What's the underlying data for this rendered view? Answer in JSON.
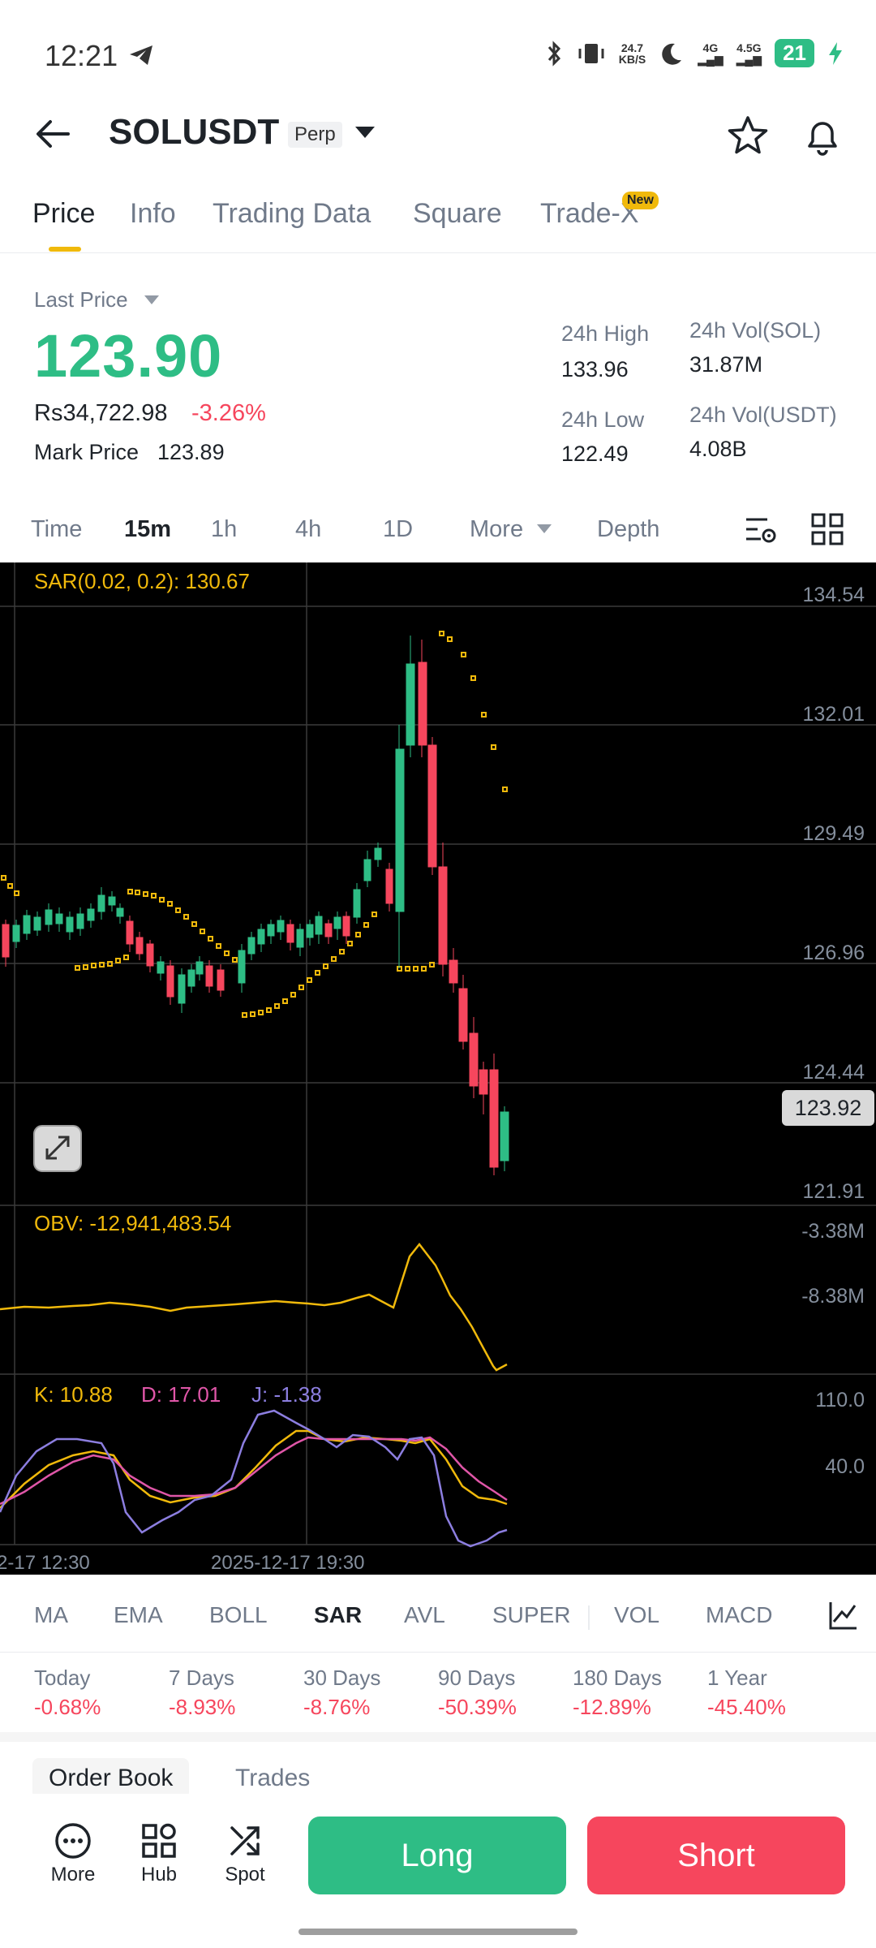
{
  "status_bar": {
    "time": "12:21",
    "net_speed_top": "24.7",
    "net_speed_bottom": "KB/S",
    "network_1": "4G",
    "network_2": "4.5G",
    "battery": "21"
  },
  "header": {
    "symbol": "SOLUSDT",
    "contract_type": "Perp"
  },
  "tabs": [
    {
      "label": "Price"
    },
    {
      "label": "Info"
    },
    {
      "label": "Trading Data"
    },
    {
      "label": "Square"
    },
    {
      "label": "Trade-X"
    }
  ],
  "new_badge": "New",
  "price_panel": {
    "last_price_label": "Last Price",
    "last_price": "123.90",
    "inr_price": "Rs34,722.98",
    "change_pct": "-3.26%",
    "mark_price_label": "Mark Price",
    "mark_price": "123.89",
    "high_label": "24h High",
    "high_value": "133.96",
    "low_label": "24h Low",
    "low_value": "122.49",
    "vol_sol_label": "24h Vol(SOL)",
    "vol_sol_value": "31.87M",
    "vol_usdt_label": "24h Vol(USDT)",
    "vol_usdt_value": "4.08B"
  },
  "intervals": [
    {
      "label": "Time"
    },
    {
      "label": "15m"
    },
    {
      "label": "1h"
    },
    {
      "label": "4h"
    },
    {
      "label": "1D"
    },
    {
      "label": "More"
    },
    {
      "label": "Depth"
    }
  ],
  "chart": {
    "sar_label": "SAR(0.02, 0.2): 130.67",
    "price_axis": [
      "134.54",
      "132.01",
      "129.49",
      "126.96",
      "124.44",
      "121.91"
    ],
    "current_price_tag": "123.92",
    "obv_label": "OBV: -12,941,483.54",
    "obv_axis": [
      "-3.38M",
      "-8.38M"
    ],
    "kdj_k": "K: 10.88",
    "kdj_d": "D: 17.01",
    "kdj_j": "J: -1.38",
    "kdj_axis": [
      "110.0",
      "40.0"
    ],
    "time_axis": [
      "2-17 12:30",
      "2025-12-17 19:30"
    ],
    "colors": {
      "up": "#2ebd85",
      "down": "#f6465d",
      "sar": "#f0b90b",
      "obv": "#f0b90b",
      "k": "#f0b90b",
      "d": "#e056a8",
      "j": "#8c7ee0"
    }
  },
  "indicators": [
    {
      "label": "MA"
    },
    {
      "label": "EMA"
    },
    {
      "label": "BOLL"
    },
    {
      "label": "SAR"
    },
    {
      "label": "AVL"
    },
    {
      "label": "SUPER"
    },
    {
      "label": "VOL"
    },
    {
      "label": "MACD"
    }
  ],
  "performance": [
    {
      "label": "Today",
      "value": "-0.68%"
    },
    {
      "label": "7 Days",
      "value": "-8.93%"
    },
    {
      "label": "30 Days",
      "value": "-8.76%"
    },
    {
      "label": "90 Days",
      "value": "-50.39%"
    },
    {
      "label": "180 Days",
      "value": "-12.89%"
    },
    {
      "label": "1 Year",
      "value": "-45.40%"
    }
  ],
  "order_book_tabs": [
    {
      "label": "Order Book"
    },
    {
      "label": "Trades"
    }
  ],
  "bottom_nav": {
    "more": "More",
    "hub": "Hub",
    "spot": "Spot",
    "long": "Long",
    "short": "Short"
  }
}
